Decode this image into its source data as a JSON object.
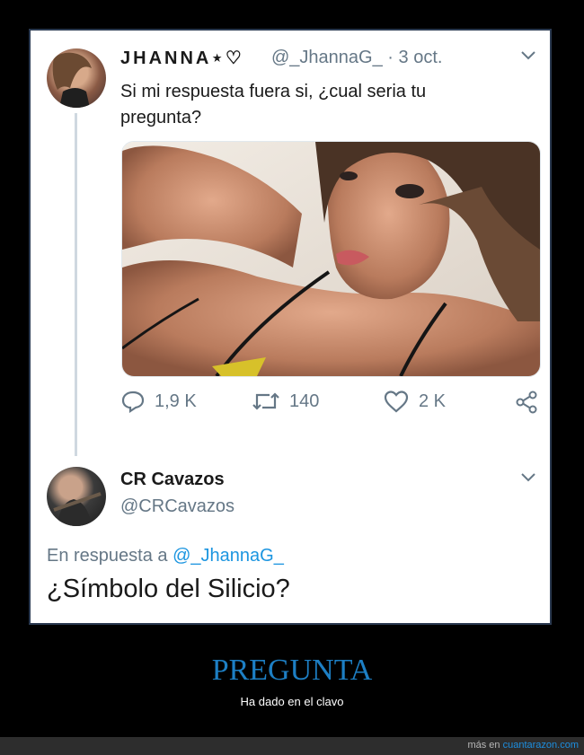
{
  "tweet1": {
    "display_name": "JHANNA⋆♡",
    "handle": "@_JhannaG_",
    "time": "· 3 oct.",
    "text": "Si mi respuesta fuera si, ¿cual seria tu pregunta?",
    "stats": {
      "replies": "1,9 K",
      "retweets": "140",
      "likes": "2 K"
    }
  },
  "tweet2": {
    "display_name": "CR Cavazos",
    "handle": "@CRCavazos",
    "reply_prefix": "En respuesta a",
    "reply_mention": "@_JhannaG_",
    "text": "¿Símbolo del Silicio?"
  },
  "caption": {
    "title": "PREGUNTA",
    "subtitle": "Ha dado en el clavo"
  },
  "footer": {
    "prefix": "más en",
    "site": "cuantarazon.com"
  },
  "colors": {
    "accent_blue": "#1d7fc4",
    "mention_blue": "#1b95e0",
    "muted_gray": "#657786"
  },
  "icons": [
    "reply-icon",
    "retweet-icon",
    "like-icon",
    "share-icon",
    "chevron-down-icon"
  ]
}
